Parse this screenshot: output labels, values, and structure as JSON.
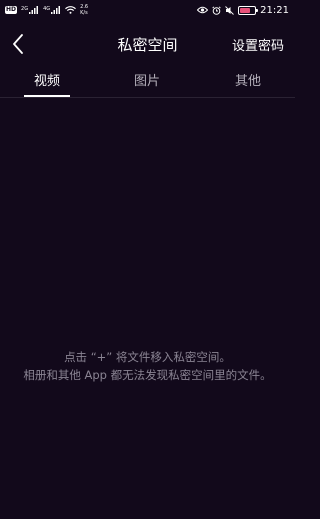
{
  "status_bar": {
    "hd_label": "HD",
    "sim1_tag": "2G",
    "sim2_tag": "4G",
    "net_speed_value": "2.6",
    "net_speed_unit": "K/s",
    "icons": [
      "hd-icon",
      "signal-icon",
      "signal-icon",
      "wifi-icon",
      "eye-icon",
      "alarm-icon",
      "mute-icon",
      "battery-icon"
    ],
    "battery_level": 0.7,
    "battery_color": "#e8527a",
    "time": "21:21"
  },
  "header": {
    "title": "私密空间",
    "set_password_label": "设置密码",
    "back_icon": "chevron-left-icon"
  },
  "tabs": [
    {
      "label": "视频",
      "active": true
    },
    {
      "label": "图片",
      "active": false
    },
    {
      "label": "其他",
      "active": false
    }
  ],
  "empty_state": {
    "line1": "点击 “+” 将文件移入私密空间。",
    "line2": "相册和其他 App 都无法发现私密空间里的文件。"
  },
  "colors": {
    "background": "#12091b",
    "text_primary": "#ffffff",
    "text_secondary": "#8a8493"
  }
}
